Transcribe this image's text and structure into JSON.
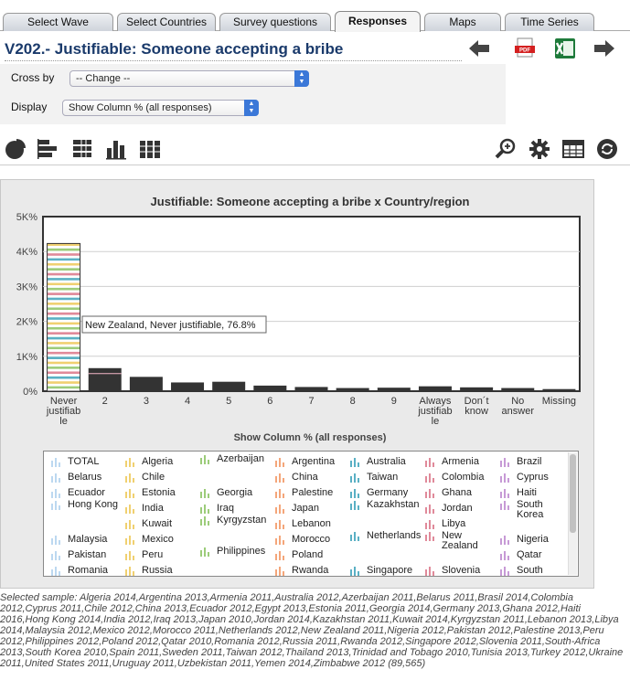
{
  "tabs": [
    "Select Wave",
    "Select Countries",
    "Survey questions",
    "Responses",
    "Maps",
    "Time Series"
  ],
  "active_tab": "Responses",
  "title": "V202.- Justifiable: Someone accepting a bribe",
  "controls": {
    "cross_label": "Cross by",
    "cross_value": "-- Change --",
    "display_label": "Display",
    "display_value": "Show Column % (all responses)"
  },
  "icons": {
    "top": [
      "arrow-left-icon",
      "pdf-icon",
      "excel-icon",
      "arrow-right-icon"
    ],
    "toolbar_left": [
      "pie-chart-icon",
      "horizontal-bar-icon",
      "stacked-bar-icon",
      "column-chart-icon",
      "stacked-column-icon"
    ],
    "toolbar_right": [
      "zoom-icon",
      "gear-icon",
      "table-icon",
      "refresh-icon"
    ]
  },
  "colors": {
    "bar": "#333333",
    "title": "#1a3a6b",
    "accent": "#3b78d8"
  },
  "chart_data": {
    "type": "bar",
    "title": "Justifiable: Someone accepting a bribe x Country/region",
    "xlabel": "Show Column % (all responses)",
    "ylabel": "",
    "ylim": [
      0,
      5000
    ],
    "yticks": [
      "0%",
      "1K%",
      "2K%",
      "3K%",
      "4K%",
      "5K%"
    ],
    "categories": [
      "Never justifiable",
      "2",
      "3",
      "4",
      "5",
      "6",
      "7",
      "8",
      "9",
      "Always justifiable",
      "Don´t know",
      "No answer",
      "Missing"
    ],
    "category_labels": [
      [
        "Never",
        "justifiab",
        "le"
      ],
      [
        "2"
      ],
      [
        "3"
      ],
      [
        "4"
      ],
      [
        "5"
      ],
      [
        "6"
      ],
      [
        "7"
      ],
      [
        "8"
      ],
      [
        "9"
      ],
      [
        "Always",
        "justifiab",
        "le"
      ],
      [
        "Don´t",
        "know"
      ],
      [
        "No",
        "answer"
      ],
      [
        "Missing"
      ]
    ],
    "values": [
      4230,
      660,
      410,
      250,
      270,
      160,
      120,
      90,
      100,
      140,
      110,
      90,
      60
    ],
    "tooltip": "New Zealand, Never justifiable, 76.8%",
    "legend_placement": "bottom",
    "grid": true
  },
  "legend": [
    [
      "TOTAL",
      "Algeria",
      "Azerbaijan",
      "Argentina",
      "Australia",
      "Armenia",
      "Brazil"
    ],
    [
      "Belarus",
      "Chile",
      "",
      "China",
      "Taiwan",
      "Colombia",
      "Cyprus"
    ],
    [
      "Ecuador",
      "Estonia",
      "Georgia",
      "Palestine",
      "Germany",
      "Ghana",
      "Haiti"
    ],
    [
      "Hong Kong",
      "India",
      "Iraq",
      "Japan",
      "Kazakhstan",
      "Jordan",
      "South Korea"
    ],
    [
      "",
      "Kuwait",
      "Kyrgyzstan",
      "Lebanon",
      "",
      "Libya",
      ""
    ],
    [
      "Malaysia",
      "Mexico",
      "",
      "Morocco",
      "Netherlands",
      "New Zealand",
      "Nigeria"
    ],
    [
      "Pakistan",
      "Peru",
      "Philippines",
      "Poland",
      "",
      "",
      "Qatar"
    ],
    [
      "Romania",
      "Russia",
      "",
      "Rwanda",
      "Singapore",
      "Slovenia",
      "South"
    ]
  ],
  "legend_colors": [
    "#bcd8f0",
    "#f0d070",
    "#9ccc7a",
    "#f4a67a",
    "#5ab0c4",
    "#e08a9a",
    "#c79ad6"
  ],
  "sample_text": "Selected sample: Algeria 2014,Argentina 2013,Armenia 2011,Australia 2012,Azerbaijan 2011,Belarus 2011,Brasil 2014,Colombia 2012,Cyprus 2011,Chile 2012,China 2013,Ecuador 2012,Egypt 2013,Estonia 2011,Georgia 2014,Germany 2013,Ghana 2012,Haiti 2016,Hong Kong 2014,India 2012,Iraq 2013,Japan 2010,Jordan 2014,Kazakhstan 2011,Kuwait 2014,Kyrgyzstan 2011,Lebanon 2013,Libya 2014,Malaysia 2012,Mexico 2012,Morocco 2011,Netherlands 2012,New Zealand 2011,Nigeria 2012,Pakistan 2012,Palestine 2013,Peru 2012,Philippines 2012,Poland 2012,Qatar 2010,Romania 2012,Russia 2011,Rwanda 2012,Singapore 2012,Slovenia 2011,South-Africa 2013,South Korea 2010,Spain 2011,Sweden 2011,Taiwan 2012,Thailand 2013,Trinidad and Tobago 2010,Tunisia 2013,Turkey 2012,Ukraine 2011,United States 2011,Uruguay 2011,Uzbekistan 2011,Yemen 2014,Zimbabwe 2012 (89,565)"
}
